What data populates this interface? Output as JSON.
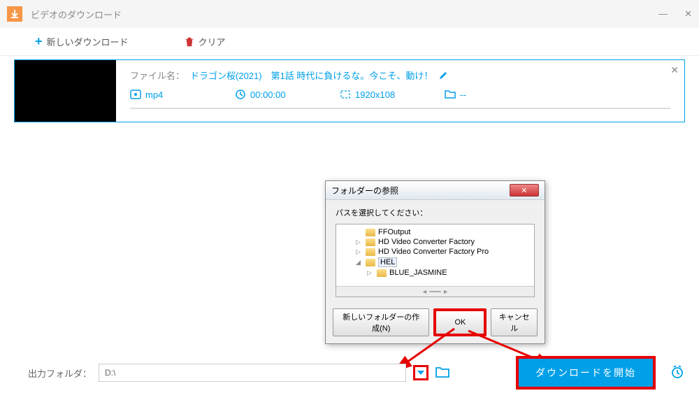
{
  "window": {
    "title": "ビデオのダウンロード"
  },
  "toolbar": {
    "new_download": "新しいダウンロード",
    "clear": "クリア"
  },
  "item": {
    "file_label": "ファイル名：",
    "file_name": "ドラゴン桜(2021)　第1話 時代に負けるな。今こそ、動け！",
    "format": "mp4",
    "duration": "00:00:00",
    "resolution": "1920x108",
    "folder": "--"
  },
  "dialog": {
    "title": "フォルダーの参照",
    "instruction": "パスを選択してください：",
    "tree": {
      "items": [
        {
          "name": "FFOutput",
          "indent": 1,
          "arrow": ""
        },
        {
          "name": "HD Video Converter Factory",
          "indent": 1,
          "arrow": "▷"
        },
        {
          "name": "HD Video Converter Factory Pro",
          "indent": 1,
          "arrow": "▷"
        },
        {
          "name": "HEL",
          "indent": 1,
          "arrow": "◢",
          "selected": true
        },
        {
          "name": "BLUE_JASMINE",
          "indent": 2,
          "arrow": "▷"
        }
      ]
    },
    "new_folder_btn": "新しいフォルダーの作成(N)",
    "ok_btn": "OK",
    "cancel_btn": "キャンセル"
  },
  "bottom": {
    "label": "出力フォルダ：",
    "path": "D:\\",
    "start_btn": "ダウンロードを開始"
  }
}
